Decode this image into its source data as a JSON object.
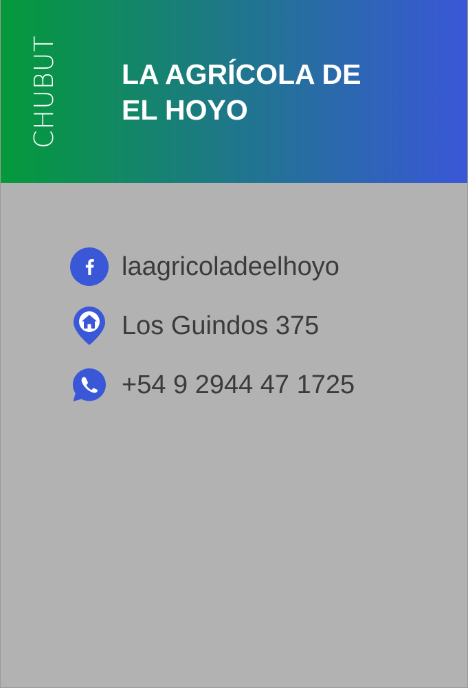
{
  "header": {
    "region": "CHUBUT",
    "title_line1": "LA AGRÍCOLA DE",
    "title_line2": "EL HOYO"
  },
  "contacts": [
    {
      "icon": "facebook-icon",
      "text": "laagricoladeelhoyo"
    },
    {
      "icon": "home-location-icon",
      "text": "Los Guindos 375"
    },
    {
      "icon": "whatsapp-icon",
      "text": "+54 9 2944 47 1725"
    }
  ],
  "colors": {
    "gradient_start": "#049a3a",
    "gradient_end": "#3a57d8",
    "icon": "#3a57d8",
    "background": "#b2b2b2",
    "text": "#3b3b3b"
  }
}
